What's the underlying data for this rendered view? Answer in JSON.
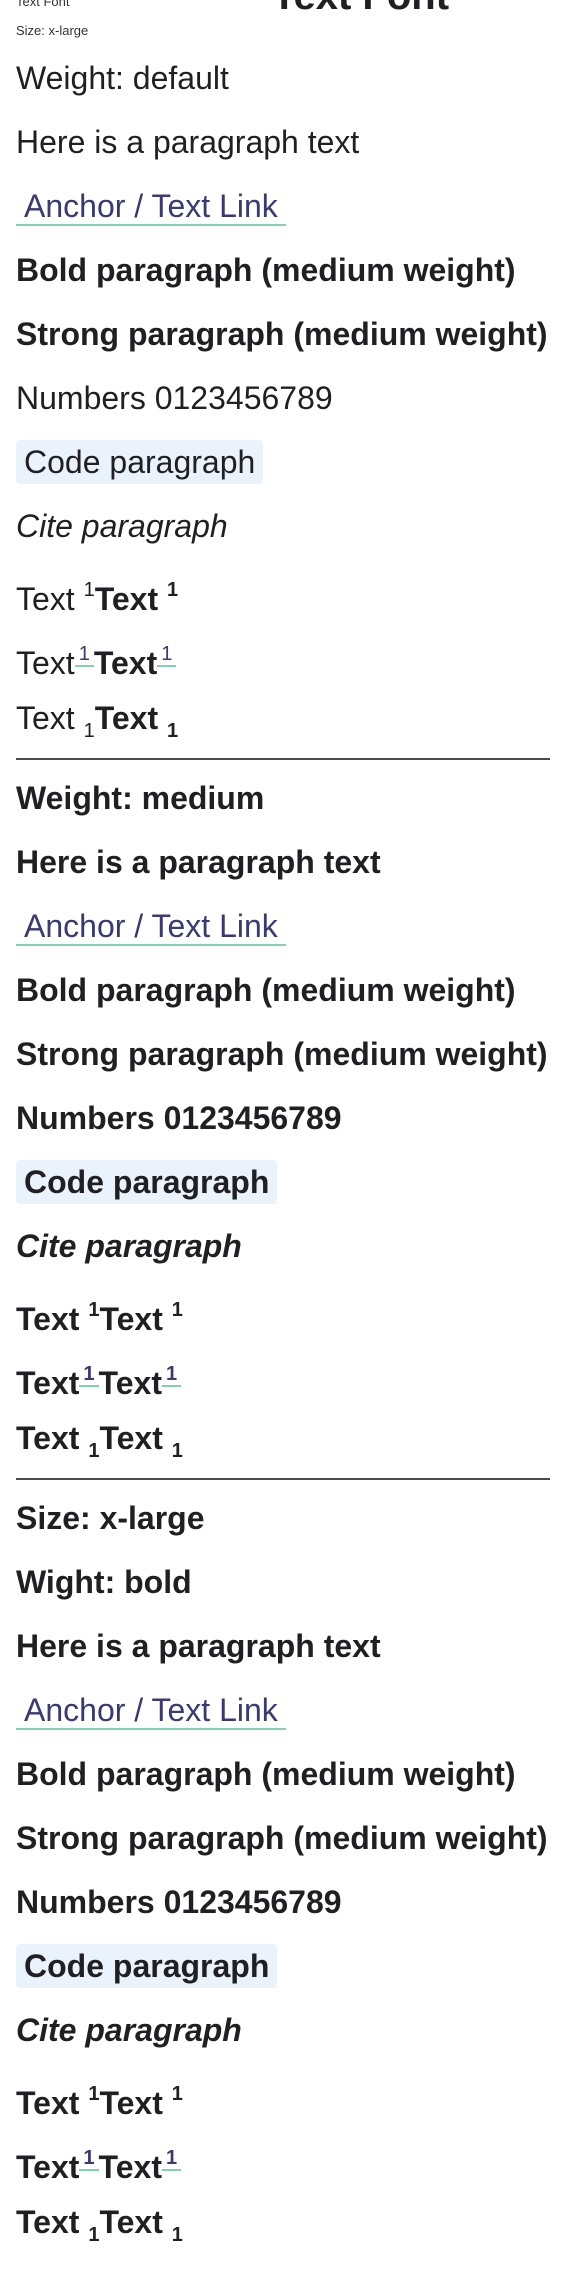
{
  "header": {
    "cut_small": "Text Font",
    "cut_big": "Text Font",
    "size_label": "Size: x-large"
  },
  "section_default": {
    "weight_label": "Weight: default",
    "paragraph": "Here is a paragraph text",
    "link": "Anchor / Text Link",
    "bold": "Bold paragraph (medium weight)",
    "strong": "Strong paragraph (medium weight)",
    "numbers": "Numbers 0123456789",
    "code": "Code paragraph",
    "cite": "Cite paragraph",
    "text": "Text",
    "mark": "1"
  },
  "section_medium": {
    "weight_label": "Weight: medium",
    "paragraph": "Here is a paragraph text",
    "link": "Anchor / Text Link",
    "bold": "Bold paragraph (medium weight)",
    "strong": "Strong paragraph (medium weight)",
    "numbers": "Numbers 0123456789",
    "code": "Code paragraph",
    "cite": "Cite paragraph",
    "text": "Text",
    "mark": "1"
  },
  "section_bold": {
    "size_label": "Size: x-large",
    "weight_label": "Wight: bold",
    "paragraph": "Here is a paragraph text",
    "link": "Anchor / Text Link",
    "bold": "Bold paragraph (medium weight)",
    "strong": "Strong paragraph (medium weight)",
    "numbers": "Numbers 0123456789",
    "code": "Code paragraph",
    "cite": "Cite paragraph",
    "text": "Text",
    "mark": "1"
  },
  "colors": {
    "link_text": "#3a3a72",
    "link_underline": "#7fd3b3",
    "code_background": "#eaf3fc",
    "divider": "#4a4a4a"
  }
}
